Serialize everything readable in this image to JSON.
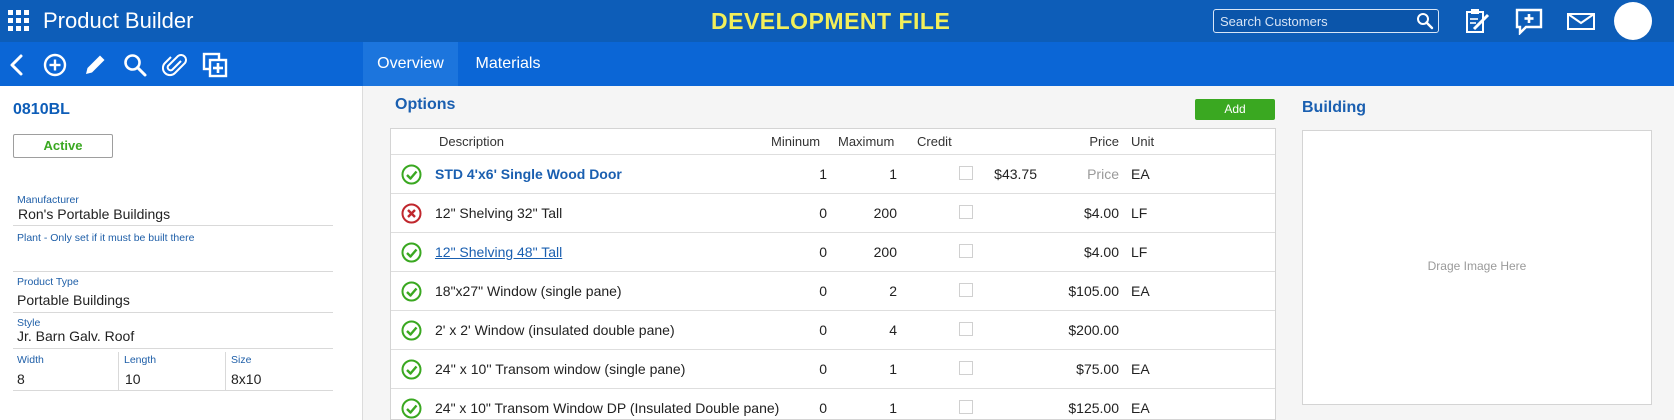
{
  "header": {
    "app_title": "Product Builder",
    "banner": "DEVELOPMENT FILE",
    "search_placeholder": "Search Customers",
    "icons": [
      "apps-grid-icon",
      "search-icon",
      "clipboard-edit-icon",
      "add-comment-icon",
      "mail-icon",
      "avatar"
    ]
  },
  "toolbar": {
    "icons": [
      "back-icon",
      "add-circle-icon",
      "edit-pencil-icon",
      "search-icon",
      "attachment-icon",
      "copy-add-icon"
    ]
  },
  "tabs": [
    {
      "label": "Overview",
      "active": true
    },
    {
      "label": "Materials",
      "active": false
    }
  ],
  "product": {
    "code": "0810BL",
    "status": "Active",
    "manufacturer_label": "Manufacturer",
    "manufacturer": "Ron's Portable Buildings",
    "plant_label": "Plant - Only set if it must be built there",
    "plant": "",
    "product_type_label": "Product Type",
    "product_type": "Portable Buildings",
    "style_label": "Style",
    "style": "Jr. Barn Galv. Roof",
    "width_label": "Width",
    "width": "8",
    "length_label": "Length",
    "length": "10",
    "size_label": "Size",
    "size": "8x10"
  },
  "options": {
    "title": "Options",
    "add_label": "Add",
    "columns": {
      "description": "Description",
      "minimum": "Mininum",
      "maximum": "Maximum",
      "credit": "Credit",
      "price": "Price",
      "unit": "Unit"
    },
    "rows": [
      {
        "status": "ok",
        "description": "STD 4'x6' Single Wood Door",
        "style": "bold",
        "minimum": "1",
        "maximum": "1",
        "credit": "$43.75",
        "price": "Price",
        "price_placeholder": true,
        "unit": "EA"
      },
      {
        "status": "error",
        "description": "12\" Shelving 32\" Tall",
        "style": "normal",
        "minimum": "0",
        "maximum": "200",
        "credit": "",
        "price": "$4.00",
        "price_placeholder": false,
        "unit": "LF"
      },
      {
        "status": "ok",
        "description": "12\" Shelving 48\" Tall",
        "style": "link",
        "minimum": "0",
        "maximum": "200",
        "credit": "",
        "price": "$4.00",
        "price_placeholder": false,
        "unit": "LF"
      },
      {
        "status": "ok",
        "description": "18\"x27\" Window (single pane)",
        "style": "normal",
        "minimum": "0",
        "maximum": "2",
        "credit": "",
        "price": "$105.00",
        "price_placeholder": false,
        "unit": "EA"
      },
      {
        "status": "ok",
        "description": "2' x 2' Window (insulated double pane)",
        "style": "normal",
        "minimum": "0",
        "maximum": "4",
        "credit": "",
        "price": "$200.00",
        "price_placeholder": false,
        "unit": ""
      },
      {
        "status": "ok",
        "description": "24'' x 10'' Transom window (single pane)",
        "style": "normal",
        "minimum": "0",
        "maximum": "1",
        "credit": "",
        "price": "$75.00",
        "price_placeholder": false,
        "unit": "EA"
      },
      {
        "status": "ok",
        "description": "24\" x 10\" Transom Window DP (Insulated Double pane)",
        "style": "normal",
        "minimum": "0",
        "maximum": "1",
        "credit": "",
        "price": "$125.00",
        "price_placeholder": false,
        "unit": "EA"
      }
    ]
  },
  "building": {
    "title": "Building",
    "drop_text": "Drage Image Here"
  },
  "colors": {
    "header_blue": "#0d5db8",
    "toolbar_blue": "#0b66d6",
    "banner_yellow": "#f2ef5a",
    "accent_green": "#3aa821",
    "error_red": "#c0272d",
    "link_blue": "#1a5fb0"
  }
}
